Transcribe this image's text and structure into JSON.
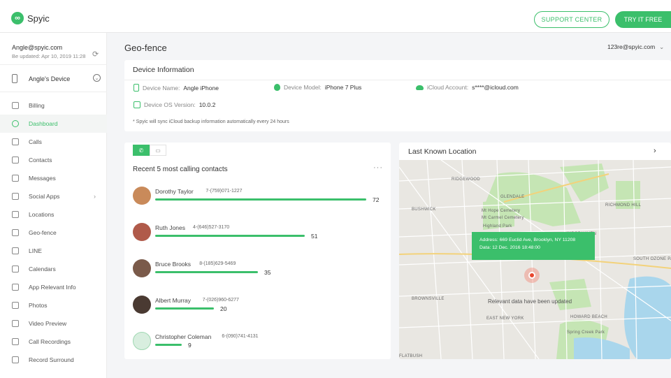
{
  "header": {
    "logo_mark": "∞",
    "logo_text": "Spyic",
    "support_label": "SUPPORT CENTER",
    "try_label": "TRY IT FREE"
  },
  "sidebar": {
    "email": "Angle@spyic.com",
    "updated": "Be updated: Apr 10, 2019 11:28",
    "device_name": "Angle's Device",
    "items": [
      {
        "label": "Billing",
        "icon": "billing-icon"
      },
      {
        "label": "Dashboard",
        "icon": "dashboard-icon",
        "active": true
      },
      {
        "label": "Calls",
        "icon": "phone-icon"
      },
      {
        "label": "Contacts",
        "icon": "contacts-icon"
      },
      {
        "label": "Messages",
        "icon": "message-icon"
      },
      {
        "label": "Social Apps",
        "icon": "chat-icon",
        "has_submenu": true
      },
      {
        "label": "Locations",
        "icon": "location-icon"
      },
      {
        "label": "Geo-fence",
        "icon": "geofence-icon"
      },
      {
        "label": "LINE",
        "icon": "line-icon"
      },
      {
        "label": "Calendars",
        "icon": "calendar-icon"
      },
      {
        "label": "App Relevant Info",
        "icon": "apps-icon"
      },
      {
        "label": "Photos",
        "icon": "photo-icon"
      },
      {
        "label": "Video Preview",
        "icon": "video-icon"
      },
      {
        "label": "Call Recordings",
        "icon": "microphone-icon"
      },
      {
        "label": "Record Surround",
        "icon": "record-icon"
      }
    ]
  },
  "main": {
    "title": "Geo-fence",
    "account": "123re@spyic.com",
    "device_info": {
      "title": "Device Information",
      "name_label": "Device Name:",
      "name_value": "Angle iPhone",
      "model_label": "Device Model:",
      "model_value": "iPhone 7 Plus",
      "icloud_label": "iCloud Account:",
      "icloud_value": "s****@icloud.com",
      "os_label": "Device OS Version:",
      "os_value": "10.0.2",
      "note": "* Spyic will sync iCloud backup information automatically every 24 hours"
    },
    "calls": {
      "tab_calls_icon": "phone-icon",
      "tab_messages_icon": "message-icon",
      "title": "Recent 5 most calling contacts",
      "max_count": 72,
      "contacts": [
        {
          "name": "Dorothy Taylor",
          "phone": "7-(759)071-1227",
          "count": 72
        },
        {
          "name": "Ruth Jones",
          "phone": "4-(646)527-3170",
          "count": 51
        },
        {
          "name": "Bruce Brooks",
          "phone": "8-(185)629-5469",
          "count": 35
        },
        {
          "name": "Albert Murray",
          "phone": "7-(026)960-6277",
          "count": 20
        },
        {
          "name": "Christopher Coleman",
          "phone": "6-(090)741-4131",
          "count": 9
        }
      ]
    },
    "location": {
      "title": "Last Known Location",
      "address": "Address: 669 Euclid Ave, Brooklyn, NY 11208",
      "date": "Data: 12 Dec. 2016 18:48:00",
      "message": "Relevant data have been updated",
      "map_labels": [
        "RIDGEWOOD",
        "GLENDALE",
        "BUSHWICK",
        "Mt Hope Cemetery",
        "Mt Carmel Cemetery",
        "Highland Park",
        "RICHMOND HILL",
        "WOODHAVEN",
        "SOUTH OZONE PARK",
        "BROWNSVILLE",
        "EAST NEW YORK",
        "HOWARD BEACH",
        "Spring Creek Park",
        "FLATBUSH"
      ]
    }
  },
  "colors": {
    "accent": "#3bbf6b",
    "pin": "#e8472e"
  }
}
